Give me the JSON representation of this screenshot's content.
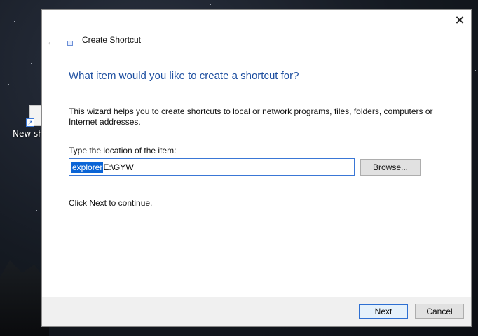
{
  "desktop": {
    "icon_label": "New sh"
  },
  "dialog": {
    "title": "Create Shortcut",
    "close_glyph": "✕",
    "back_glyph": "←",
    "heading": "What item would you like to create a shortcut for?",
    "description": "This wizard helps you to create shortcuts to local or network programs, files, folders, computers or Internet addresses.",
    "field_label": "Type the location of the item:",
    "location_selected": "explorer",
    "location_rest": " E:\\GYW",
    "browse_label": "Browse...",
    "continue_text": "Click Next to continue.",
    "next_label": "Next",
    "cancel_label": "Cancel"
  },
  "icons": {
    "close": "close-icon",
    "back": "back-arrow-icon",
    "wizard": "shortcut-icon"
  },
  "colors": {
    "heading": "#1e4fa0",
    "accent": "#2d6fd2",
    "selection": "#0a64d6"
  }
}
